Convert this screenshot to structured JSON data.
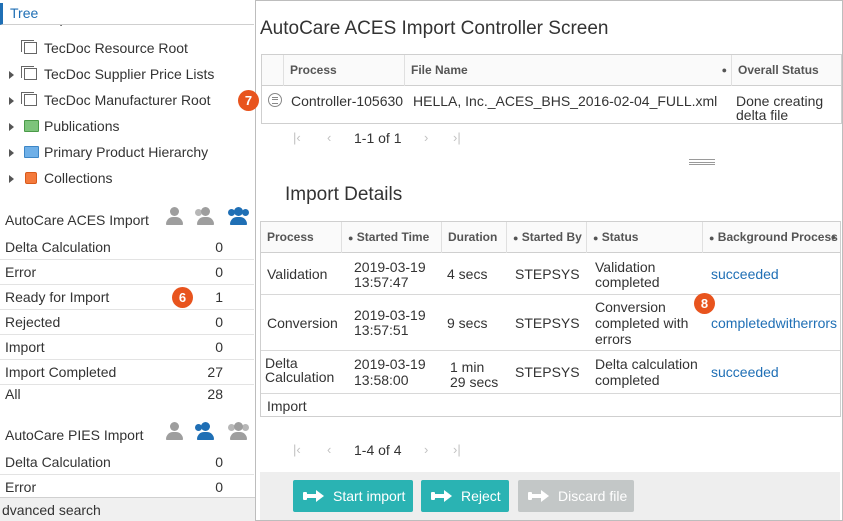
{
  "left": {
    "tree_tab": "Tree",
    "tree_items": [
      {
        "label": "Import Flow Root",
        "icon": "document-icon",
        "arrow": false
      },
      {
        "label": "TecDoc Resource Root",
        "icon": "document-icon",
        "arrow": false
      },
      {
        "label": "TecDoc Supplier Price Lists",
        "icon": "document-icon",
        "arrow": true
      },
      {
        "label": "TecDoc Manufacturer Root",
        "icon": "document-icon",
        "arrow": true
      },
      {
        "label": "Publications",
        "icon": "green-folder-icon",
        "arrow": true
      },
      {
        "label": "Primary Product Hierarchy",
        "icon": "blue-folder-icon",
        "arrow": true
      },
      {
        "label": "Collections",
        "icon": "collection-icon",
        "arrow": true
      }
    ],
    "aces_section": {
      "title": "AutoCare ACES Import",
      "rows": [
        {
          "name": "Delta Calculation",
          "count": "0"
        },
        {
          "name": "Error",
          "count": "0"
        },
        {
          "name": "Ready for Import",
          "count": "1"
        },
        {
          "name": "Rejected",
          "count": "0"
        },
        {
          "name": "Import",
          "count": "0"
        },
        {
          "name": "Import Completed",
          "count": "27"
        },
        {
          "name": "All",
          "count": "28"
        }
      ]
    },
    "pies_section": {
      "title": "AutoCare PIES Import",
      "rows": [
        {
          "name": "Delta Calculation",
          "count": "0"
        },
        {
          "name": "Error",
          "count": "0"
        }
      ]
    },
    "advanced_search": "dvanced search"
  },
  "callouts": {
    "six": "6",
    "seven": "7",
    "eight": "8"
  },
  "main": {
    "title": "AutoCare ACES Import Controller Screen",
    "top_grid": {
      "headers": [
        "Process",
        "File Name",
        "Overall Status"
      ],
      "row": {
        "process": "Controller-105630",
        "file_name": "HELLA, Inc._ACES_BHS_2016-02-04_FULL.xml",
        "status_line1": "Done creating",
        "status_line2": "delta file"
      }
    },
    "top_pager": "1-1 of 1",
    "details_title": "Import Details",
    "details_grid": {
      "headers": [
        "Process",
        "Started Time",
        "Duration",
        "Started By",
        "Status",
        "Background Process"
      ],
      "rows": [
        {
          "process": [
            "Validation"
          ],
          "time": [
            "2019-03-19",
            "13:57:47"
          ],
          "duration": [
            "4 secs"
          ],
          "by": "STEPSYS",
          "status": [
            "Validation",
            "completed"
          ],
          "bg": "succeeded"
        },
        {
          "process": [
            "Conversion"
          ],
          "time": [
            "2019-03-19",
            "13:57:51"
          ],
          "duration": [
            "9 secs"
          ],
          "by": "STEPSYS",
          "status": [
            "Conversion",
            "completed with",
            "errors"
          ],
          "bg": "completedwitherrors"
        },
        {
          "process": [
            "Delta",
            "Calculation"
          ],
          "time": [
            "2019-03-19",
            "13:58:00"
          ],
          "duration": [
            "1 min",
            "29 secs"
          ],
          "by": "STEPSYS",
          "status": [
            "Delta calculation",
            "completed"
          ],
          "bg": "succeeded"
        }
      ],
      "last_row": "Import"
    },
    "details_pager": "1-4 of 4",
    "buttons": {
      "start_import": "Start import",
      "reject": "Reject",
      "discard": "Discard file"
    }
  },
  "colors": {
    "accent": "#1f6fb5",
    "button": "#2ab3b3",
    "callout": "#e8541e"
  }
}
